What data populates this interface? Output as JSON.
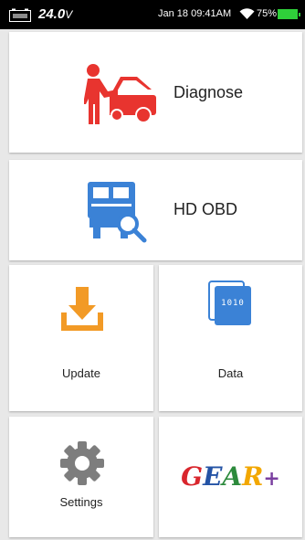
{
  "status": {
    "voltage": "24.0",
    "voltage_unit": "V",
    "datetime": "Jan 18 09:41AM",
    "battery_percent": "75%",
    "battery_color": "#2fd03a"
  },
  "tiles": {
    "diagnose": {
      "label": "Diagnose",
      "icon": "car-mechanic-icon",
      "color": "#e8342f"
    },
    "hd_obd": {
      "label": "HD OBD",
      "icon": "truck-search-icon",
      "color": "#3b82d6"
    },
    "update": {
      "label": "Update",
      "icon": "download-icon",
      "color": "#f29a26"
    },
    "data": {
      "label": "Data",
      "icon": "data-file-icon",
      "icon_text": "1010",
      "color": "#3b82d6"
    },
    "settings": {
      "label": "Settings",
      "icon": "gear-icon",
      "color": "#7d7d7d"
    },
    "gear_plus": {
      "logo_g": "G",
      "logo_e": "E",
      "logo_a": "A",
      "logo_r": "R",
      "logo_plus": "+"
    }
  }
}
